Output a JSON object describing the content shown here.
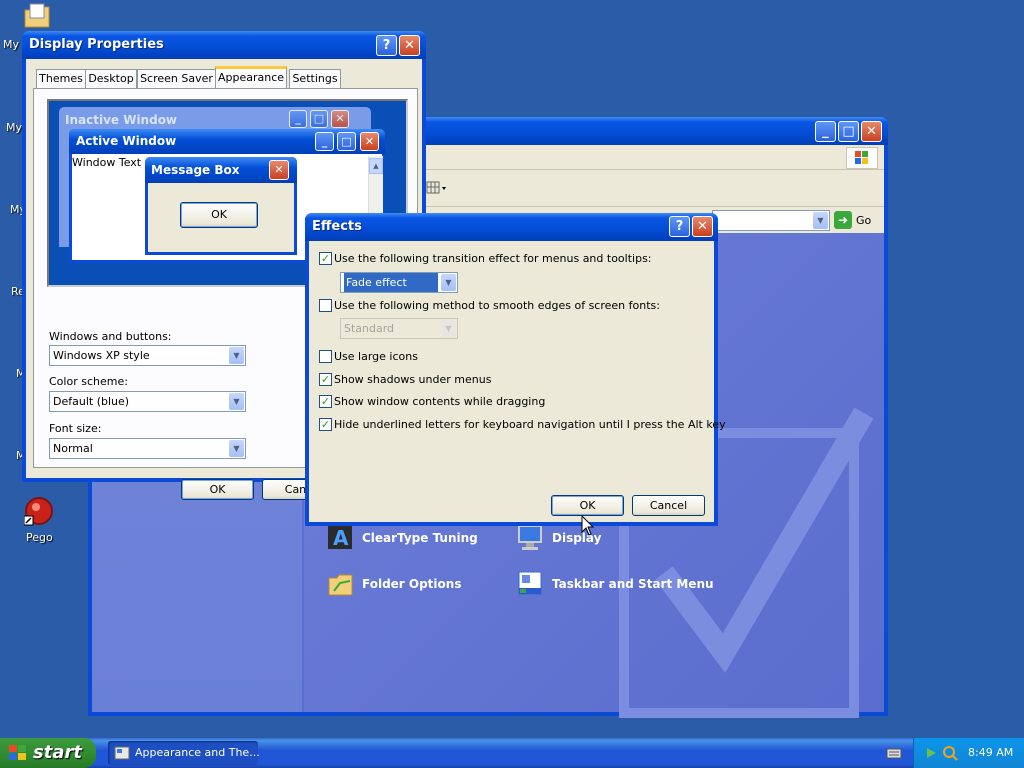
{
  "desktop": {
    "icons": [
      {
        "label": "My I"
      },
      {
        "label": "My"
      },
      {
        "label": "My"
      },
      {
        "label": "Re"
      },
      {
        "label": "M"
      },
      {
        "label": "M"
      },
      {
        "label": "Pego"
      }
    ]
  },
  "control_panel": {
    "go_label": "Go",
    "items": [
      {
        "label": "ClearType Tuning",
        "icon": "cleartype-icon"
      },
      {
        "label": "Display",
        "icon": "display-icon"
      },
      {
        "label": "Folder Options",
        "icon": "folder-options-icon"
      },
      {
        "label": "Taskbar and Start Menu",
        "icon": "taskbar-icon"
      }
    ]
  },
  "display_properties": {
    "title": "Display Properties",
    "tabs": [
      "Themes",
      "Desktop",
      "Screen Saver",
      "Appearance",
      "Settings"
    ],
    "active_tab": "Appearance",
    "preview": {
      "inactive_title": "Inactive Window",
      "active_title": "Active Window",
      "window_text": "Window Text",
      "message_box_title": "Message Box",
      "message_box_ok": "OK"
    },
    "windows_buttons_label": "Windows and buttons:",
    "windows_buttons_value": "Windows XP style",
    "color_scheme_label": "Color scheme:",
    "color_scheme_value": "Default (blue)",
    "font_size_label": "Font size:",
    "font_size_value": "Normal",
    "ok_label": "OK",
    "cancel_label": "Canc"
  },
  "effects": {
    "title": "Effects",
    "transition_label": "Use the following transition effect for menus and tooltips:",
    "transition_checked": true,
    "transition_value": "Fade effect",
    "smooth_label": "Use the following method to smooth edges of screen fonts:",
    "smooth_checked": false,
    "smooth_value": "Standard",
    "large_icons_label": "Use large icons",
    "large_icons_checked": false,
    "shadows_label": "Show shadows under menus",
    "shadows_checked": true,
    "drag_label": "Show window contents while dragging",
    "drag_checked": true,
    "underline_label": "Hide underlined letters for keyboard navigation until I press the Alt key",
    "underline_checked": true,
    "ok_label": "OK",
    "cancel_label": "Cancel"
  },
  "taskbar": {
    "start_label": "start",
    "task_label": "Appearance and The...",
    "clock": "8:49 AM"
  },
  "colors": {
    "desktop": "#2b5ca8",
    "xp_blue": "#0450d8",
    "panel_bg": "#5a6fd0",
    "dialog_bg": "#ece9d8",
    "start_green": "#2f8a2f"
  }
}
